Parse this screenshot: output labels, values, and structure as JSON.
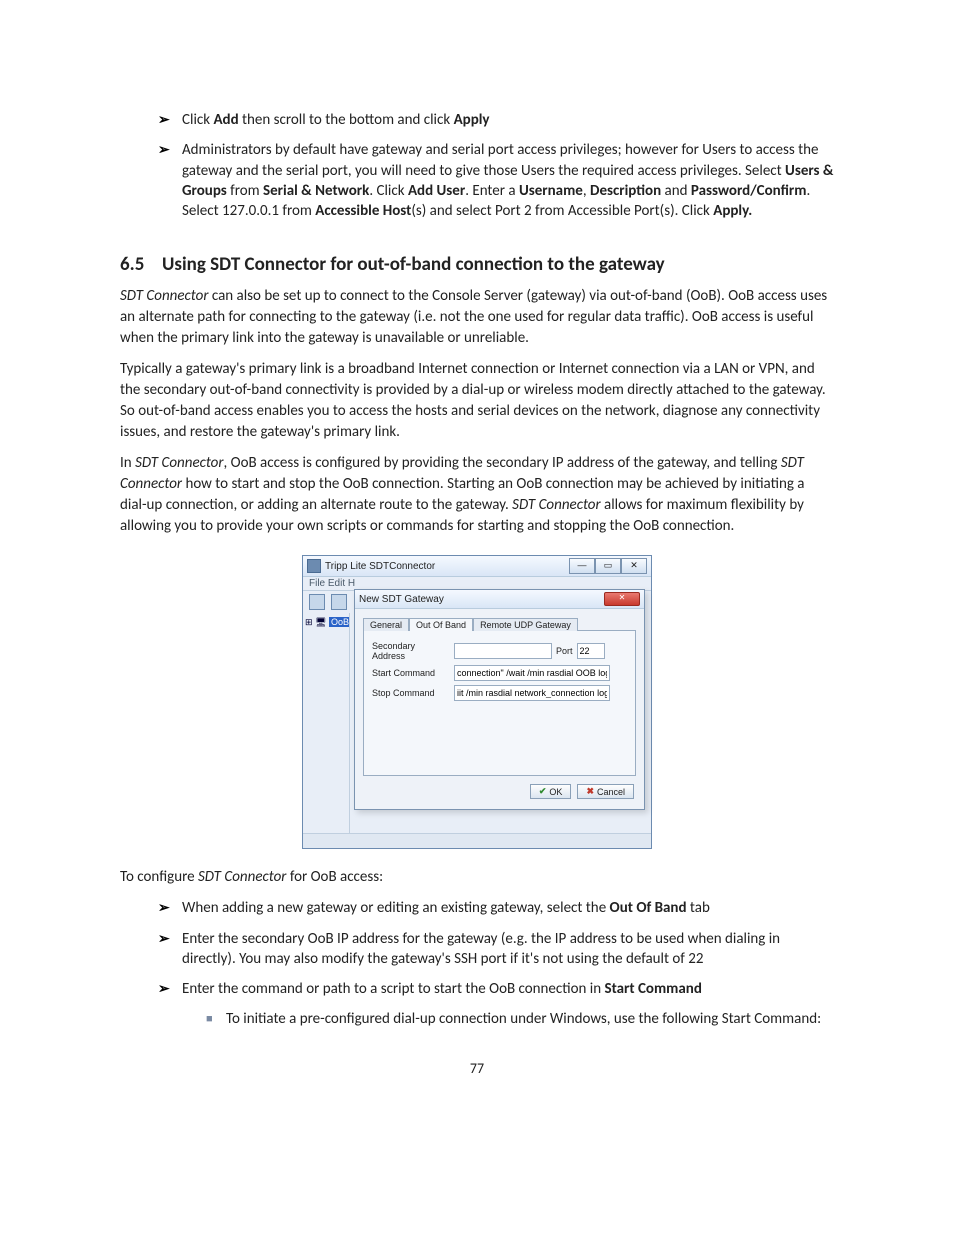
{
  "pageNumber": "77",
  "bullets1": {
    "b1": {
      "pre": "Click ",
      "bold1": "Add",
      "mid": " then scroll to the bottom and click ",
      "bold2": "Apply"
    },
    "b2": {
      "t1": "Administrators by default have gateway and serial port access privileges; however for Users to access the gateway and the serial port, you will need to give those Users the required access privileges. Select ",
      "b_ug": "Users & Groups",
      "t2": " from ",
      "b_sn": "Serial & Network",
      "t3": ". Click ",
      "b_add": "Add User",
      "t4": ". Enter a ",
      "b_un": "Username",
      "t5": ", ",
      "b_desc": "Description",
      "t6": " and ",
      "b_pw": "Password/Confirm",
      "t7": ". Select 127.0.0.1 from ",
      "b_ah": "Accessible Host",
      "t8": "(s) and select Port 2 from Accessible Port(s). Click ",
      "b_apply": "Apply."
    }
  },
  "section": {
    "num": "6.5",
    "title": "Using SDT Connector for out-of-band connection to the gateway"
  },
  "paras": {
    "p1a": "SDT Connector",
    "p1b": " can also be set up to connect to the Console Server (gateway) via out-of-band (OoB). OoB access uses an alternate path for connecting to the gateway (i.e. not the one used for regular data traffic). OoB access is useful when the primary link into the gateway is unavailable or unreliable.",
    "p2": "Typically a gateway's primary link is a broadband Internet connection or Internet connection via a LAN or VPN, and the secondary out-of-band connectivity is provided by a dial-up or wireless modem directly attached to the gateway. So out-of-band access enables you to access the hosts and serial devices on the network, diagnose any connectivity issues, and restore the gateway's primary link.",
    "p3a": "In ",
    "p3b": "SDT Connector",
    "p3c": ", OoB access is configured by providing the secondary IP address of the gateway, and telling ",
    "p3d": "SDT Connector",
    "p3e": " how to start and stop the OoB connection. Starting an OoB connection may be achieved by initiating a dial-up connection, or adding an alternate route to the gateway. ",
    "p3f": "SDT Connector",
    "p3g": " allows for maximum flexibility by allowing you to provide your own scripts or commands for starting and stopping the OoB connection.",
    "p4a": "To configure ",
    "p4b": "SDT Connector",
    "p4c": " for OoB access:"
  },
  "bullets2": {
    "b1a": "When adding a new gateway or editing an existing gateway, select the ",
    "b1b": "Out Of Band",
    "b1c": " tab",
    "b2": "Enter the secondary OoB IP address for the gateway (e.g. the IP address to be used when dialing in directly). You may also modify the gateway's SSH port if it's not using the default of 22",
    "b3a": "Enter the command or path to a script to start the OoB connection in ",
    "b3b": "Start Command",
    "sub1": "To initiate a pre-configured dial-up connection under Windows, use the following Start Command:"
  },
  "screenshot": {
    "mainTitle": "Tripp Lite SDTConnector",
    "menu": "File   Edit   H",
    "treeItem": "OoB",
    "dlgTitle": "New SDT Gateway",
    "tabs": {
      "general": "General",
      "oob": "Out Of Band",
      "rudp": "Remote UDP Gateway"
    },
    "labels": {
      "sec": "Secondary Address",
      "port": "Port",
      "start": "Start Command",
      "stop": "Stop Command"
    },
    "values": {
      "sec": "",
      "port": "22",
      "start": "connection\" /wait /min rasdial OOB login password",
      "stop": "iit /min rasdial network_connection login password"
    },
    "buttons": {
      "ok": "OK",
      "cancel": "Cancel"
    }
  }
}
